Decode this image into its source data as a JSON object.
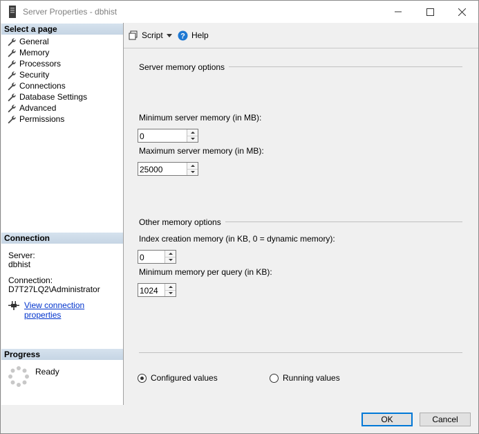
{
  "window": {
    "title": "Server Properties - dbhist"
  },
  "left": {
    "select_page_header": "Select a page",
    "pages": [
      {
        "label": "General"
      },
      {
        "label": "Memory"
      },
      {
        "label": "Processors"
      },
      {
        "label": "Security"
      },
      {
        "label": "Connections"
      },
      {
        "label": "Database Settings"
      },
      {
        "label": "Advanced"
      },
      {
        "label": "Permissions"
      }
    ],
    "connection_header": "Connection",
    "server_label": "Server:",
    "server_value": "dbhist",
    "connection_label": "Connection:",
    "connection_value": "D7T27LQ2\\Administrator",
    "view_connection_link": "View connection properties",
    "progress_header": "Progress",
    "progress_status": "Ready"
  },
  "toolbar": {
    "script_label": "Script",
    "help_label": "Help"
  },
  "main": {
    "server_memory_group": "Server memory options",
    "min_memory_label": "Minimum server memory (in MB):",
    "min_memory_value": "0",
    "max_memory_label": "Maximum server memory (in MB):",
    "max_memory_value": "25000",
    "other_memory_group": "Other memory options",
    "index_memory_label": "Index creation memory (in KB, 0 = dynamic memory):",
    "index_memory_value": "0",
    "min_query_label": "Minimum memory per query (in KB):",
    "min_query_value": "1024",
    "configured_values_label": "Configured values",
    "running_values_label": "Running values",
    "selected_radio": "configured"
  },
  "footer": {
    "ok_label": "OK",
    "cancel_label": "Cancel"
  }
}
